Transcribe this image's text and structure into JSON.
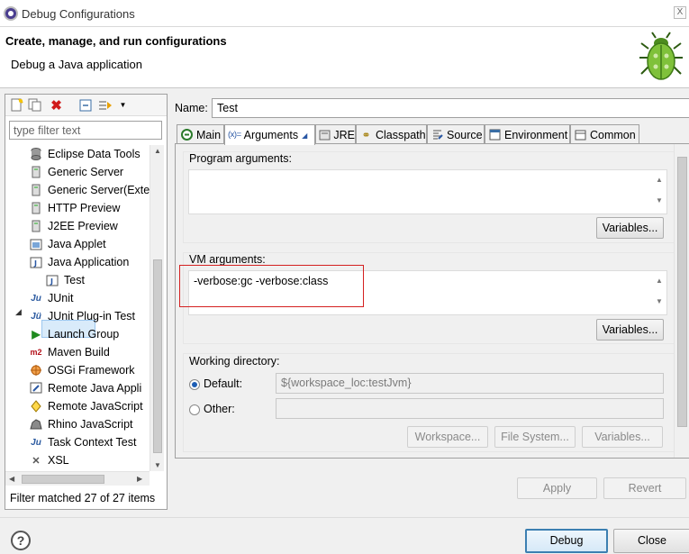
{
  "window": {
    "title": "Debug Configurations",
    "close_glyph": "X"
  },
  "header": {
    "title": "Create, manage, and run configurations",
    "description": "Debug a Java application"
  },
  "left_panel": {
    "toolbar_icons": [
      "new-config-icon",
      "duplicate-icon",
      "delete-icon",
      "collapse-all-icon",
      "filter-icon",
      "dropdown-icon"
    ],
    "filter_placeholder": "type filter text",
    "tree": [
      {
        "label": "Eclipse Data Tools",
        "icon": "database-icon",
        "level": 1
      },
      {
        "label": "Generic Server",
        "icon": "server-icon",
        "level": 1
      },
      {
        "label": "Generic Server(Exte",
        "icon": "server-icon",
        "level": 1
      },
      {
        "label": "HTTP Preview",
        "icon": "server-icon",
        "level": 1
      },
      {
        "label": "J2EE Preview",
        "icon": "server-icon",
        "level": 1
      },
      {
        "label": "Java Applet",
        "icon": "applet-icon",
        "level": 1
      },
      {
        "label": "Java Application",
        "icon": "java-app-icon",
        "level": 1,
        "expanded": true
      },
      {
        "label": "Test",
        "icon": "java-app-icon",
        "level": 2,
        "selected": true
      },
      {
        "label": "JUnit",
        "icon": "junit-icon",
        "level": 1
      },
      {
        "label": "JUnit Plug-in Test",
        "icon": "junit-plugin-icon",
        "level": 1
      },
      {
        "label": "Launch Group",
        "icon": "launch-group-icon",
        "level": 1
      },
      {
        "label": "Maven Build",
        "icon": "maven-icon",
        "level": 1
      },
      {
        "label": "OSGi Framework",
        "icon": "osgi-icon",
        "level": 1
      },
      {
        "label": "Remote Java Appli",
        "icon": "remote-java-icon",
        "level": 1
      },
      {
        "label": "Remote JavaScript",
        "icon": "remote-js-icon",
        "level": 1
      },
      {
        "label": "Rhino JavaScript",
        "icon": "rhino-icon",
        "level": 1
      },
      {
        "label": "Task Context Test",
        "icon": "task-context-icon",
        "level": 1
      },
      {
        "label": "XSL",
        "icon": "xsl-icon",
        "level": 1
      }
    ],
    "status": "Filter matched 27 of 27 items"
  },
  "config": {
    "name_label": "Name:",
    "name_value": "Test",
    "tabs": [
      {
        "label": "Main",
        "icon": "main-tab-icon"
      },
      {
        "label": "Arguments",
        "icon": "arguments-icon",
        "active": true
      },
      {
        "label": "JRE",
        "icon": "jre-icon"
      },
      {
        "label": "Classpath",
        "icon": "classpath-icon"
      },
      {
        "label": "Source",
        "icon": "source-icon"
      },
      {
        "label": "Environment",
        "icon": "environment-icon"
      },
      {
        "label": "Common",
        "icon": "common-icon"
      }
    ],
    "arguments_tab_icon_text": "(x)=",
    "program_arguments": {
      "label": "Program arguments:",
      "value": "",
      "variables_button": "Variables..."
    },
    "vm_arguments": {
      "label": "VM arguments:",
      "value": "-verbose:gc -verbose:class",
      "variables_button": "Variables..."
    },
    "working_directory": {
      "label": "Working directory:",
      "default_label": "Default:",
      "default_checked": true,
      "default_value": "${workspace_loc:testJvm}",
      "other_label": "Other:",
      "other_value": "",
      "buttons": [
        "Workspace...",
        "File System...",
        "Variables..."
      ]
    },
    "apply_button": "Apply",
    "revert_button": "Revert"
  },
  "footer": {
    "help_glyph": "?",
    "debug_button": "Debug",
    "close_button": "Close"
  },
  "colors": {
    "highlight_box": "#d42020",
    "selection": "#d9ebfa",
    "default_button_border": "#3c7fb1"
  }
}
